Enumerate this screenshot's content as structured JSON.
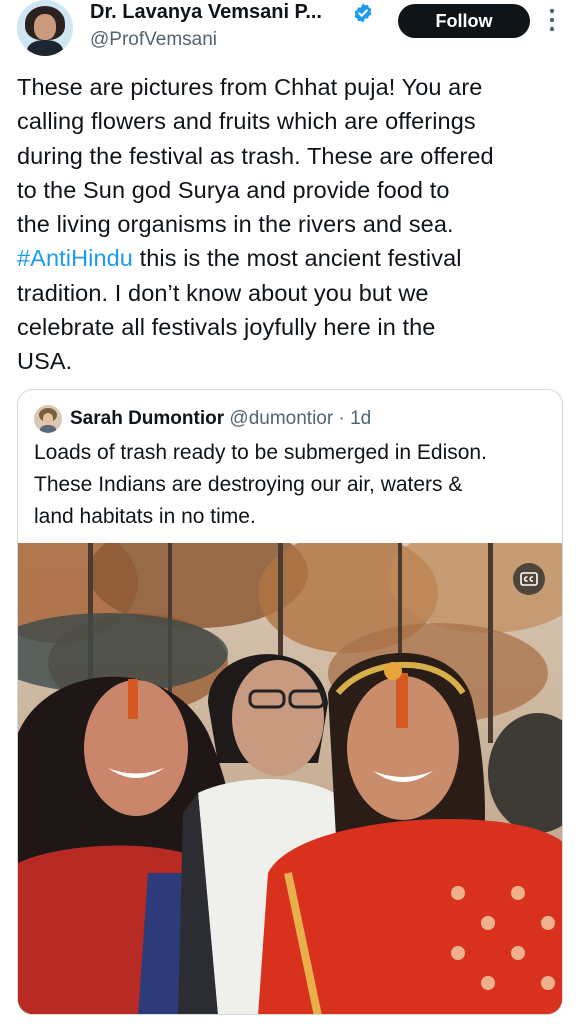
{
  "author": {
    "display_name": "Dr. Lavanya Vemsani P...",
    "handle": "@ProfVemsani",
    "avatar_icon": "profile-photo",
    "verified_icon": "verified-badge-icon"
  },
  "follow_label": "Follow",
  "tweet": {
    "lines": [
      "These are pictures from Chhat puja! You are",
      "calling flowers and fruits which are offerings",
      "during the festival as trash. These are offered",
      "to the Sun god Surya and provide food to",
      "the living organisms in the rivers and sea."
    ],
    "hashtag": "#AntiHindu",
    "hashtag_rest": " this is the most ancient festival",
    "lines_after": [
      "tradition. I don’t know about you but we",
      "celebrate all festivals joyfully here in the",
      "USA."
    ]
  },
  "quote": {
    "name": "Sarah Dumontior",
    "handle": "@dumontior",
    "separator": " · ",
    "time": "1d",
    "lines": [
      "Loads of trash ready to be submerged in Edison.",
      "These Indians are destroying our air, waters &",
      "land habitats in no time."
    ],
    "media_icon": "video-thumbnail",
    "cc_icon": "closed-captions-icon"
  },
  "colors": {
    "accent": "#1d9bf0",
    "text": "#0f1419",
    "secondary": "#536471",
    "border": "#cfd9de"
  }
}
